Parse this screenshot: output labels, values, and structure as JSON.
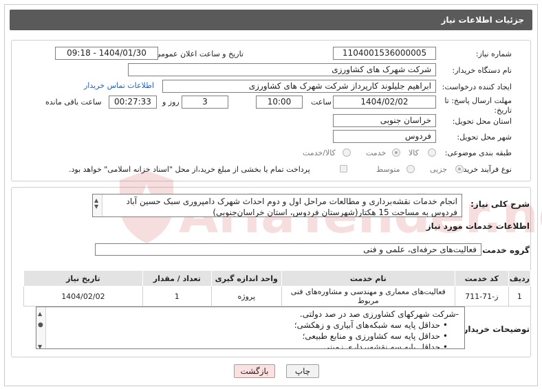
{
  "header": {
    "title": "جزئیات اطلاعات نیاز"
  },
  "fields": {
    "need_number_label": "شماره نیاز:",
    "need_number": "1104001536000005",
    "announce_label": "تاریخ و ساعت اعلان عمومی:",
    "announce_value": "1404/01/30 - 09:18",
    "buyer_org_label": "نام دستگاه خریدار:",
    "buyer_org": "شرکت شهرک های کشاورزی",
    "requester_label": "ایجاد کننده درخواست:",
    "requester": "ابراهیم جلیلوند کارپرداز شرکت شهرک های کشاورزی",
    "contact_link": "اطلاعات تماس خریدار",
    "deadline_label_1": "مهلت ارسال پاسخ: تا",
    "deadline_label_2": "تاریخ:",
    "deadline_date": "1404/02/02",
    "time_label": "ساعت",
    "deadline_time": "10:00",
    "days_value": "3",
    "days_label": "روز و",
    "remaining_value": "00:27:33",
    "remaining_label": "ساعت باقی مانده",
    "province_label": "استان محل تحویل:",
    "province": "خراسان جنوبی",
    "city_label": "شهر محل تحویل:",
    "city": "فردوس",
    "category_label": "طبقه بندی موضوعی:",
    "category_options": [
      "کالا",
      "خدمت",
      "کالا/خدمت"
    ],
    "category_selected": "خدمت",
    "process_label": "نوع فرآیند خرید :",
    "process_options": [
      "جزیی",
      "متوسط"
    ],
    "process_selected": "جزیی",
    "payment_note": "پرداخت تمام یا بخشی از مبلغ خرید،از محل \"اسناد خزانه اسلامی\" خواهد بود."
  },
  "description": {
    "label": "شرح کلی نیاز:",
    "text": "انجام خدمات نقشه‌برداری و مطالعات مراحل اول و دوم احداث شهرک دامپروری سبک حسین آباد فردوس به مساحت 15 هکتار(شهرستان فردوس، استان خراسان‌جنوبی)"
  },
  "services": {
    "section_title": "اطلاعات خدمات مورد نیاز",
    "group_label": "گروه خدمت:",
    "group_value": "فعالیت‌های حرفه‌ای، علمی و فنی",
    "columns": [
      "ردیف",
      "کد خدمت",
      "نام خدمت",
      "واحد اندازه گیری",
      "تعداد / مقدار",
      "تاریخ نیاز"
    ],
    "rows": [
      [
        "1",
        "ز-71-711",
        "فعالیت‌های معماری و مهندسی و مشاوره‌های فنی مربوط",
        "پروژه",
        "1",
        "1404/02/02"
      ]
    ]
  },
  "buyer_notes": {
    "label": "توضیحات خریدار:",
    "lines": [
      "-شرکت شهرکهای کشاورزی صد در صد دولتی.",
      "حداقل پایه سه شبکه‌های آبیاری و زهکشی؛",
      "حداقل پایه سه کشاورزی و منابع طبیعی؛",
      "حداقل پایه سه نقشه‌برداری زمینی."
    ]
  },
  "buttons": {
    "print": "چاپ",
    "back": "بازگشت"
  },
  "watermark": {
    "text": "AriaTender.neT"
  },
  "colors": {
    "header_bg": "#5a5a5a",
    "link": "#1b63c6",
    "back_button": "#fde1e1",
    "watermark": "#c71e1e"
  }
}
